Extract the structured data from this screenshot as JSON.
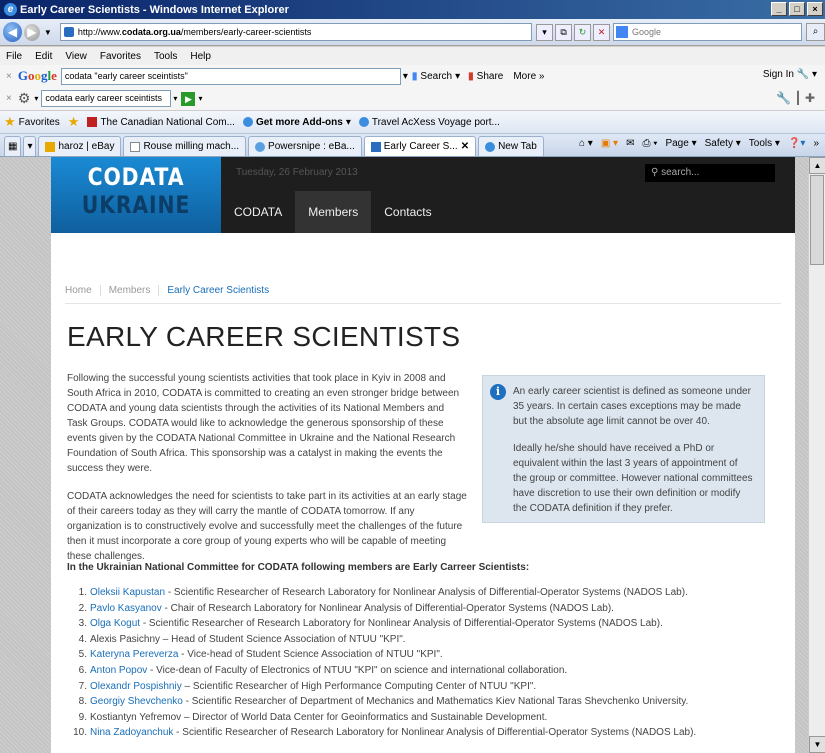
{
  "window": {
    "title": "Early Career Scientists - Windows Internet Explorer"
  },
  "address": {
    "prefix": "http://www.",
    "domain": "codata.org.ua",
    "path": "/members/early-career-scientists"
  },
  "search_box": {
    "placeholder": "Google"
  },
  "menu": [
    "File",
    "Edit",
    "View",
    "Favorites",
    "Tools",
    "Help"
  ],
  "google_toolbar": {
    "query": "codata \"early career sceintists\"",
    "search": "Search",
    "share": "Share",
    "more": "More »",
    "signin": "Sign In"
  },
  "toolbar2": {
    "query": "codata early career sceintists"
  },
  "favorites": {
    "label": "Favorites",
    "items": [
      "The Canadian National Com...",
      "Get more Add-ons",
      "Travel AcXess Voyage port..."
    ]
  },
  "tabs": [
    "haroz | eBay",
    "Rouse milling mach...",
    "Powersnipe : eBa...",
    "Early Career S...",
    "New Tab"
  ],
  "tab_tools": {
    "page": "Page",
    "safety": "Safety",
    "tools": "Tools"
  },
  "site": {
    "logo_line1": "CODATA",
    "logo_line2": "UKRAINE",
    "date": "Tuesday, 26 February 2013",
    "search_placeholder": "search...",
    "nav": [
      "CODATA",
      "Members",
      "Contacts"
    ]
  },
  "breadcrumb": [
    "Home",
    "Members",
    "Early Career Scientists"
  ],
  "page_title": "EARLY CAREER SCIENTISTS",
  "intro": [
    "Following the successful young scientists activities that took place in Kyiv in 2008 and South Africa in 2010, CODATA is committed to creating an even stronger bridge between CODATA and young data scientists through the activities of its National Members and Task Groups. CODATA would like to acknowledge the generous sponsorship of these events given by the CODATA National Committee in Ukraine and the National Research Foundation of South Africa. This sponsorship was a catalyst in making the events the success they were.",
    "CODATA acknowledges the need for scientists to take part in its activities at an early stage of their careers today as they will carry the mantle of CODATA tomorrow. If any organization is to constructively evolve and successfully meet the challenges of the future then it must incorporate a core group of young experts who will be capable of meeting these challenges."
  ],
  "info": [
    "An early career scientist is defined as someone under 35 years. In certain cases exceptions may be made but the absolute age limit cannot be over 40.",
    "Ideally he/she should have received a PhD or equivalent within the last 3 years of appointment of the group or committee. However national committees have discretion to use their own definition or modify the CODATA definition if they prefer."
  ],
  "list_heading": "In the Ukrainian National Committee for CODATA following members are Early Carreer Scientists:",
  "members": [
    {
      "n": "1.",
      "name": "Oleksii Kapustan",
      "linked": true,
      "rest": " - Scientific Researcher of Research Laboratory for Nonlinear Analysis of Differential-Operator Systems (NADOS Lab)."
    },
    {
      "n": "2.",
      "name": "Pavlo Kasyanov",
      "linked": true,
      "rest": " - Chair of Research Laboratory for Nonlinear Analysis of Differential-Operator Systems (NADOS Lab)."
    },
    {
      "n": "3.",
      "name": "Olga Kogut",
      "linked": true,
      "rest": " - Scientific Researcher of Research Laboratory for Nonlinear Analysis of Differential-Operator Systems (NADOS Lab)."
    },
    {
      "n": "4.",
      "name": "Alexis Pasichny",
      "linked": false,
      "rest": " – Head of Student Science Association of NTUU \"KPI\"."
    },
    {
      "n": "5.",
      "name": "Kateryna Pereverza",
      "linked": true,
      "rest": " - Vice-head of Student Science Association of NTUU \"KPI\"."
    },
    {
      "n": "6.",
      "name": "Anton Popov",
      "linked": true,
      "rest": " - Vice-dean of Faculty of Electronics of NTUU \"KPI\" on science and international collaboration."
    },
    {
      "n": "7.",
      "name": "Olexandr Pospishniy",
      "linked": true,
      "rest": " – Scientific Researcher of High Performance Computing Center of NTUU \"KPI\"."
    },
    {
      "n": "8.",
      "name": "Georgiy Shevchenko",
      "linked": true,
      "rest": " - Scientific Researcher of Department of Mechanics and Mathematics Kiev National Taras Shevchenko University."
    },
    {
      "n": "9.",
      "name": "Kostiantyn Yefremov",
      "linked": false,
      "rest": " – Director of World Data Center for Geoinformatics and Sustainable Development."
    },
    {
      "n": "10.",
      "name": "Nina Zadoyanchuk",
      "linked": true,
      "rest": " - Scientific Researcher of Research Laboratory for Nonlinear Analysis of Differential-Operator Systems (NADOS Lab)."
    }
  ]
}
